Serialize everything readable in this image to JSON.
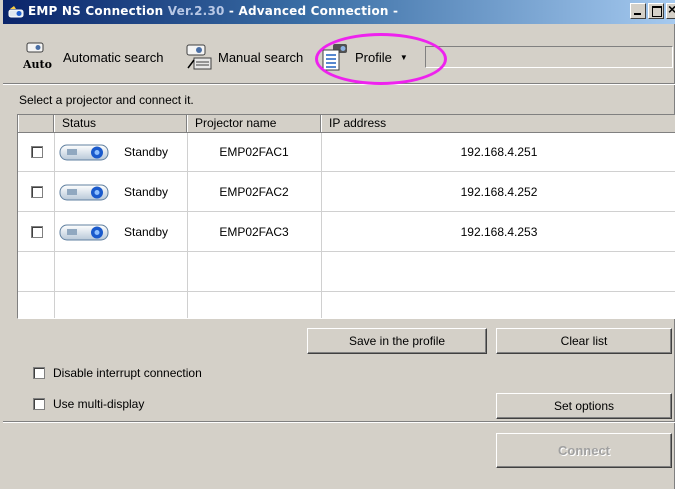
{
  "window": {
    "title_main": "EMP NS Connection",
    "title_version": "Ver.2.30",
    "title_rest": " - Advanced Connection -"
  },
  "toolbar": {
    "automatic_search": "Automatic search",
    "auto_icon_caption": "Auto",
    "manual_search": "Manual search",
    "profile": "Profile"
  },
  "hint": "Select a projector and connect it.",
  "table": {
    "columns": [
      "Status",
      "Projector name",
      "IP address"
    ],
    "rows": [
      {
        "status": "Standby",
        "name": "EMP02FAC1",
        "ip": "192.168.4.251"
      },
      {
        "status": "Standby",
        "name": "EMP02FAC2",
        "ip": "192.168.4.252"
      },
      {
        "status": "Standby",
        "name": "EMP02FAC3",
        "ip": "192.168.4.253"
      }
    ]
  },
  "buttons": {
    "save_profile": "Save in the profile",
    "clear_list": "Clear list",
    "set_options": "Set options",
    "connect": "Connect"
  },
  "options": {
    "disable_interrupt": "Disable interrupt connection",
    "multi_display": "Use multi-display"
  },
  "colors": {
    "highlight_ring": "#ee22ee",
    "title_bar": "#0a246a",
    "face": "#d4d0c8"
  },
  "icons": [
    "app-icon",
    "automatic-search-icon",
    "manual-search-icon",
    "profile-icon",
    "projector-icon",
    "minimize-icon",
    "maximize-icon",
    "close-icon"
  ]
}
